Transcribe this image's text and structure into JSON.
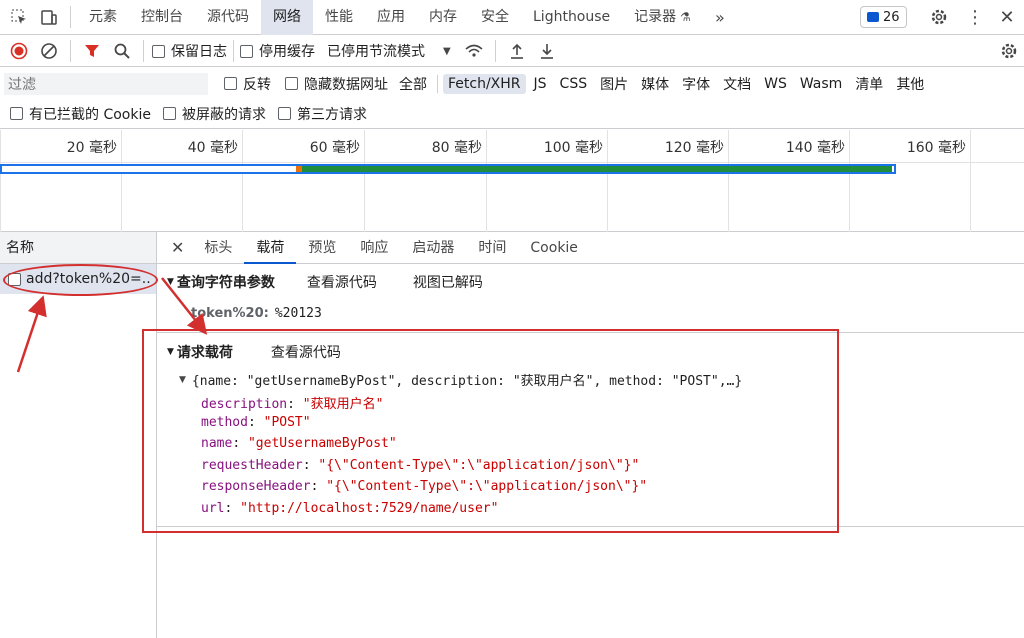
{
  "top_tabs": [
    "元素",
    "控制台",
    "源代码",
    "网络",
    "性能",
    "应用",
    "内存",
    "安全",
    "Lighthouse",
    "记录器"
  ],
  "active_top_tab": "网络",
  "issues_count": "26",
  "toolbar": {
    "preserve_log": "保留日志",
    "disable_cache": "停用缓存",
    "throttling": "已停用节流模式"
  },
  "filter": {
    "placeholder": "过滤",
    "invert": "反转",
    "hide_data_urls": "隐藏数据网址",
    "types": [
      "全部",
      "Fetch/XHR",
      "JS",
      "CSS",
      "图片",
      "媒体",
      "字体",
      "文档",
      "WS",
      "Wasm",
      "清单",
      "其他"
    ],
    "active_type": "Fetch/XHR",
    "blocked_cookies": "有已拦截的 Cookie",
    "blocked_requests": "被屏蔽的请求",
    "third_party": "第三方请求"
  },
  "timeline": {
    "ticks": [
      "20 毫秒",
      "40 毫秒",
      "60 毫秒",
      "80 毫秒",
      "100 毫秒",
      "120 毫秒",
      "140 毫秒",
      "160 毫秒"
    ]
  },
  "request_list": {
    "header": "名称",
    "items": [
      "add?token%20=..."
    ]
  },
  "detail_tabs": [
    "标头",
    "载荷",
    "预览",
    "响应",
    "启动器",
    "时间",
    "Cookie"
  ],
  "active_detail_tab": "载荷",
  "query_section": {
    "title": "查询字符串参数",
    "view_source": "查看源代码",
    "view_decoded": "视图已解码",
    "param_key": "token%20",
    "param_value": "%20123"
  },
  "payload_section": {
    "title": "请求载荷",
    "view_source": "查看源代码",
    "summary": "{name: \"getUsernameByPost\", description: \"获取用户名\", method: \"POST\",…}",
    "fields": [
      {
        "key": "description",
        "value": "\"获取用户名\""
      },
      {
        "key": "method",
        "value": "\"POST\""
      },
      {
        "key": "name",
        "value": "\"getUsernameByPost\""
      },
      {
        "key": "requestHeader",
        "value": "\"{\\\"Content-Type\\\":\\\"application/json\\\"}\""
      },
      {
        "key": "responseHeader",
        "value": "\"{\\\"Content-Type\\\":\\\"application/json\\\"}\""
      },
      {
        "key": "url",
        "value": "\"http://localhost:7529/name/user\""
      }
    ]
  },
  "colors": {
    "accent": "#0b57d0",
    "annotation": "#d32f2f",
    "record": "#d93025",
    "filter_icon": "#d93025",
    "bar_blue": "#1a73e8",
    "bar_green": "#1e8e3e"
  }
}
